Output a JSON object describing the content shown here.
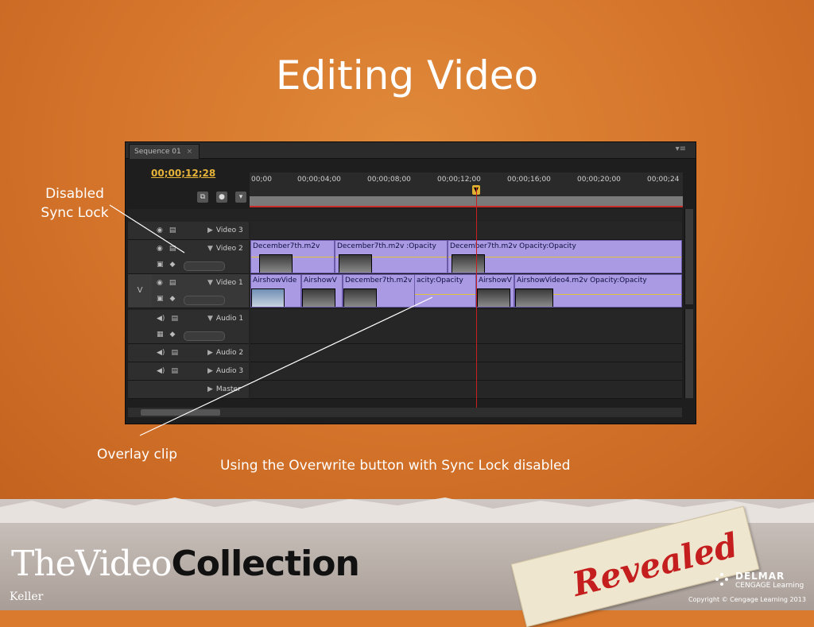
{
  "slide": {
    "title": "Editing Video",
    "callout_sync_lock": [
      "Disabled",
      "Sync Lock"
    ],
    "callout_overlay": "Overlay clip",
    "caption": "Using the Overwrite button with Sync Lock disabled"
  },
  "panel": {
    "tab_label": "Sequence 01",
    "tab_close": "×",
    "panel_menu": "▾≡",
    "timecode": "00;00;12;28",
    "ruler_ticks": [
      "00;00",
      "00;00;04;00",
      "00;00;08;00",
      "00;00;12;00",
      "00;00;16;00",
      "00;00;20;00",
      "00;00;24"
    ],
    "track_v_label": "V",
    "tracks": {
      "video3": "Video 3",
      "video2": "Video 2",
      "video1": "Video 1",
      "audio1": "Audio 1",
      "audio2": "Audio 2",
      "audio3": "Audio 3",
      "master": "Master"
    },
    "video2_clips": [
      "December7th.m2v",
      "December7th.m2v :Opacity",
      "December7th.m2v Opacity:Opacity"
    ],
    "video1_clips": [
      "AirshowVide",
      "AirshowV",
      "December7th.m2v",
      "acity:Opacity",
      "AirshowV",
      "AirshowVideo4.m2v Opacity:Opacity"
    ]
  },
  "branding": {
    "series_light": "TheVideo",
    "series_bold": "Collection",
    "author": "Keller",
    "tagline": "Revealed",
    "publisher": "DELMAR",
    "publisher_sub": "CENGAGE Learning",
    "copyright": "Copyright © Cengage Learning 2013"
  },
  "colors": {
    "background": "#d4732a",
    "clip": "#a99ae3",
    "timecode": "#e6b43a",
    "playhead": "#c82020",
    "revealed": "#c41e1e"
  }
}
